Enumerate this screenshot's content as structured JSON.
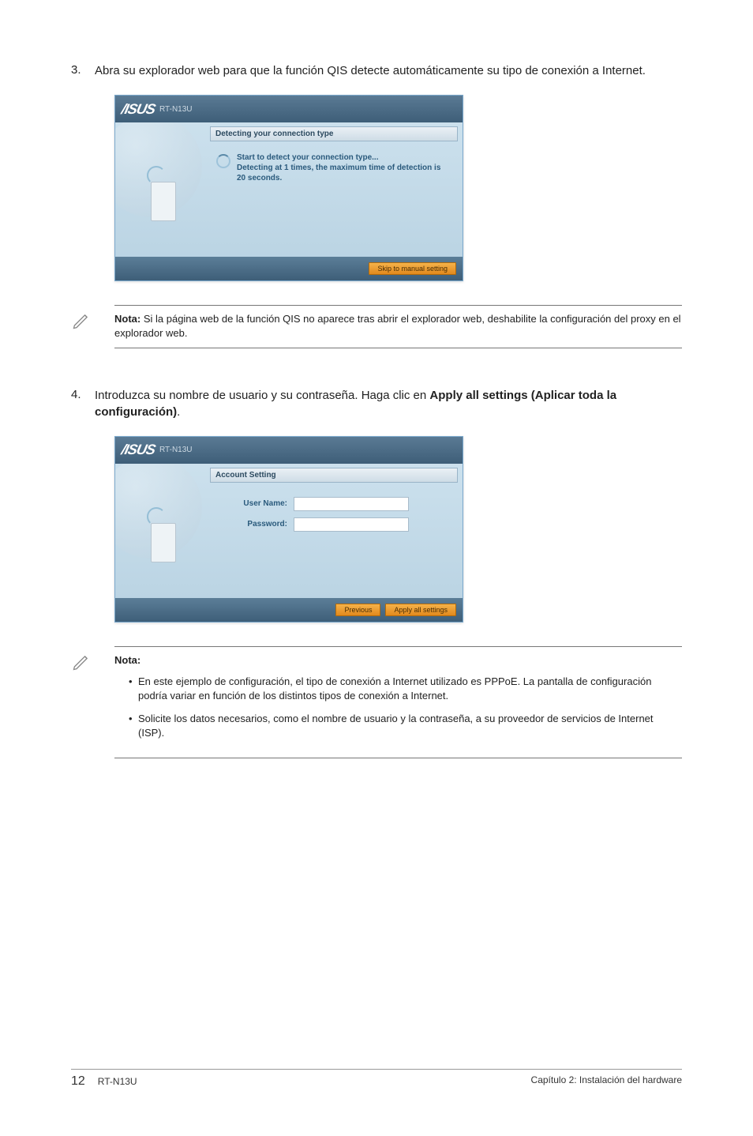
{
  "step3": {
    "num": "3.",
    "text": "Abra su explorador web para que la función QIS detecte automáticamente su tipo de conexión a Internet."
  },
  "screenshot1": {
    "model": "RT-N13U",
    "panel_title": "Detecting your connection type",
    "line1": "Start to detect your connection type...",
    "line2": "Detecting at 1 times, the maximum time of detection is 20 seconds.",
    "skip_btn": "Skip to manual setting"
  },
  "note1": {
    "label": "Nota:",
    "text": " Si la página web de la función QIS no aparece tras abrir el explorador web, deshabilite la configuración del proxy en el explorador web."
  },
  "step4": {
    "num": "4.",
    "text_a": "Introduzca su nombre de usuario y su contraseña. Haga clic en ",
    "text_b": "Apply all settings (Aplicar toda la configuración)",
    "text_c": "."
  },
  "screenshot2": {
    "model": "RT-N13U",
    "panel_title": "Account Setting",
    "user_label": "User Name:",
    "pass_label": "Password:",
    "prev_btn": "Previous",
    "apply_btn": "Apply all settings"
  },
  "note2": {
    "label": "Nota:",
    "bullet1": "En este ejemplo de configuración, el tipo de conexión a Internet utilizado es PPPoE. La pantalla de configuración podría variar en función de los distintos tipos de conexión a Internet.",
    "bullet2": "Solicite los datos necesarios, como el nombre de usuario y la contraseña, a su proveedor de servicios de Internet (ISP)."
  },
  "footer": {
    "page": "12",
    "model": "RT-N13U",
    "chapter": "Capítulo 2: Instalación del hardware"
  }
}
